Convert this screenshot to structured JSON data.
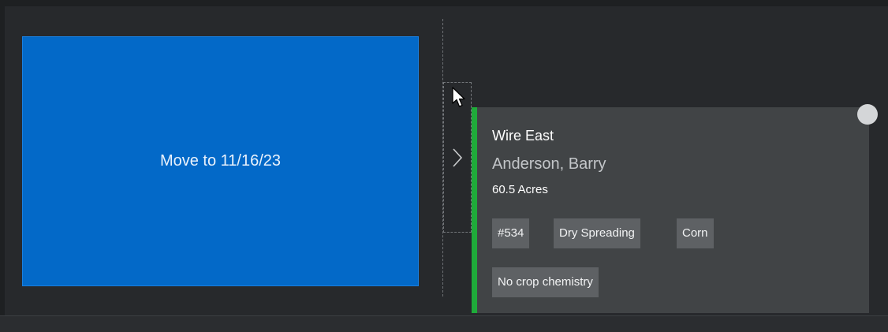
{
  "drop_target": {
    "label": "Move to 11/16/23",
    "color": "#0369c8"
  },
  "drag_handle": {
    "icon": "chevron-right-icon"
  },
  "cursor": {
    "icon": "mouse-pointer-icon"
  },
  "job_card": {
    "accent_color": "#1fab3a",
    "title": "Wire East",
    "grower": "Anderson, Barry",
    "acres": "60.5 Acres",
    "tags": [
      "#534",
      "Dry Spreading",
      "Corn",
      "No crop chemistry"
    ],
    "status_indicator": "status-dot-icon"
  }
}
